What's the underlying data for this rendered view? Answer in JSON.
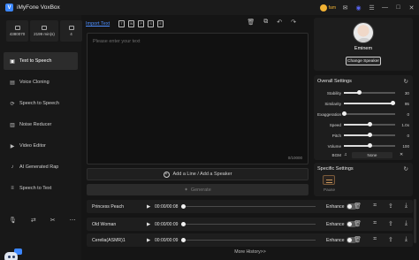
{
  "app": {
    "title": "iMyFone VoxBox",
    "logo_letter": "V",
    "user": "fam"
  },
  "sidebar": {
    "stats": [
      {
        "value": "4380070"
      },
      {
        "value": "2199 min(s)"
      },
      {
        "value": "4"
      }
    ],
    "items": [
      {
        "label": "Text to Speech",
        "icon": "text-speech-icon",
        "active": true
      },
      {
        "label": "Voice Cloning",
        "icon": "voice-cloning-icon"
      },
      {
        "label": "Speech to Speech",
        "icon": "speech-to-speech-icon"
      },
      {
        "label": "Noise Reducer",
        "icon": "noise-reducer-icon"
      },
      {
        "label": "Video Editor",
        "icon": "video-editor-icon"
      },
      {
        "label": "AI Generated Rap",
        "icon": "rap-icon"
      },
      {
        "label": "Speech to Text",
        "icon": "speech-to-text-icon"
      }
    ]
  },
  "editor": {
    "import_label": "Import Text",
    "placeholder": "Please enter your text",
    "char_count": "0/10000",
    "add_line_label": "Add a Line / Add a Speaker",
    "generate_label": "Generate"
  },
  "speaker": {
    "name": "Eminem",
    "change_label": "Change Speaker"
  },
  "overall_settings": {
    "title": "Overall Settings",
    "sliders": [
      {
        "label": "Stability",
        "value": "30",
        "level": 0.3
      },
      {
        "label": "Similarity",
        "value": "95",
        "level": 0.95
      },
      {
        "label": "Exaggeration",
        "value": "0",
        "level": 0.0
      },
      {
        "label": "Speed",
        "value": "1.0x",
        "level": 0.5
      },
      {
        "label": "Pitch",
        "value": "0",
        "level": 0.5
      },
      {
        "label": "Volume",
        "value": "100",
        "level": 0.5
      }
    ],
    "bgm_label": "BGM",
    "bgm_value": "None"
  },
  "specific_settings": {
    "title": "Specific Settings",
    "pause_label": "Pause"
  },
  "outputs": [
    {
      "name": "Princess Peach",
      "time": "00:00/00:08",
      "enhance": "Enhance"
    },
    {
      "name": "Old Woman",
      "time": "00:00/00:09",
      "enhance": "Enhance"
    },
    {
      "name": "Cerelia(ASMR)14",
      "time": "00:00/00:09",
      "enhance": "Enhance"
    }
  ],
  "more_history": "More History>>"
}
